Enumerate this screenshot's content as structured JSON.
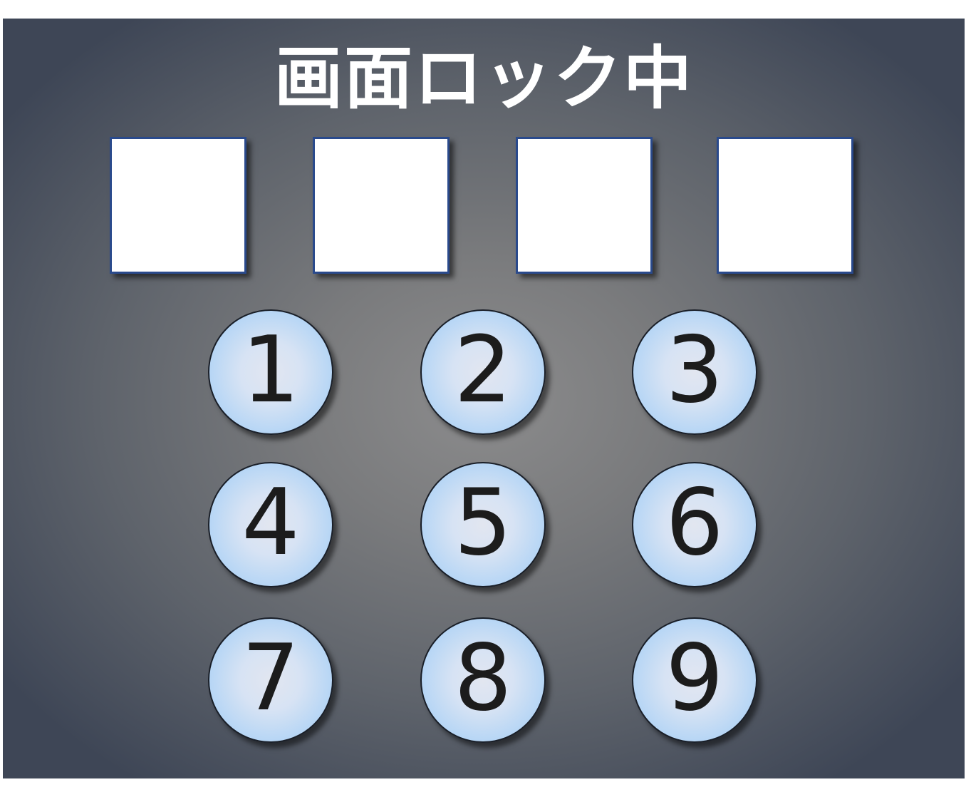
{
  "screen": {
    "title": "画面ロック中"
  },
  "pin": {
    "slots": [
      "",
      "",
      "",
      ""
    ]
  },
  "keypad": {
    "keys": [
      "1",
      "2",
      "3",
      "4",
      "5",
      "6",
      "7",
      "8",
      "9"
    ]
  },
  "colors": {
    "background_center": "#8c8c8d",
    "background_edge": "#3e4656",
    "slot_fill": "#ffffff",
    "slot_border": "#2a4a8c",
    "key_fill": "#d7e3f4",
    "key_rim": "#9bcbf3",
    "key_text": "#1c1c1c",
    "title_text": "#ffffff"
  }
}
